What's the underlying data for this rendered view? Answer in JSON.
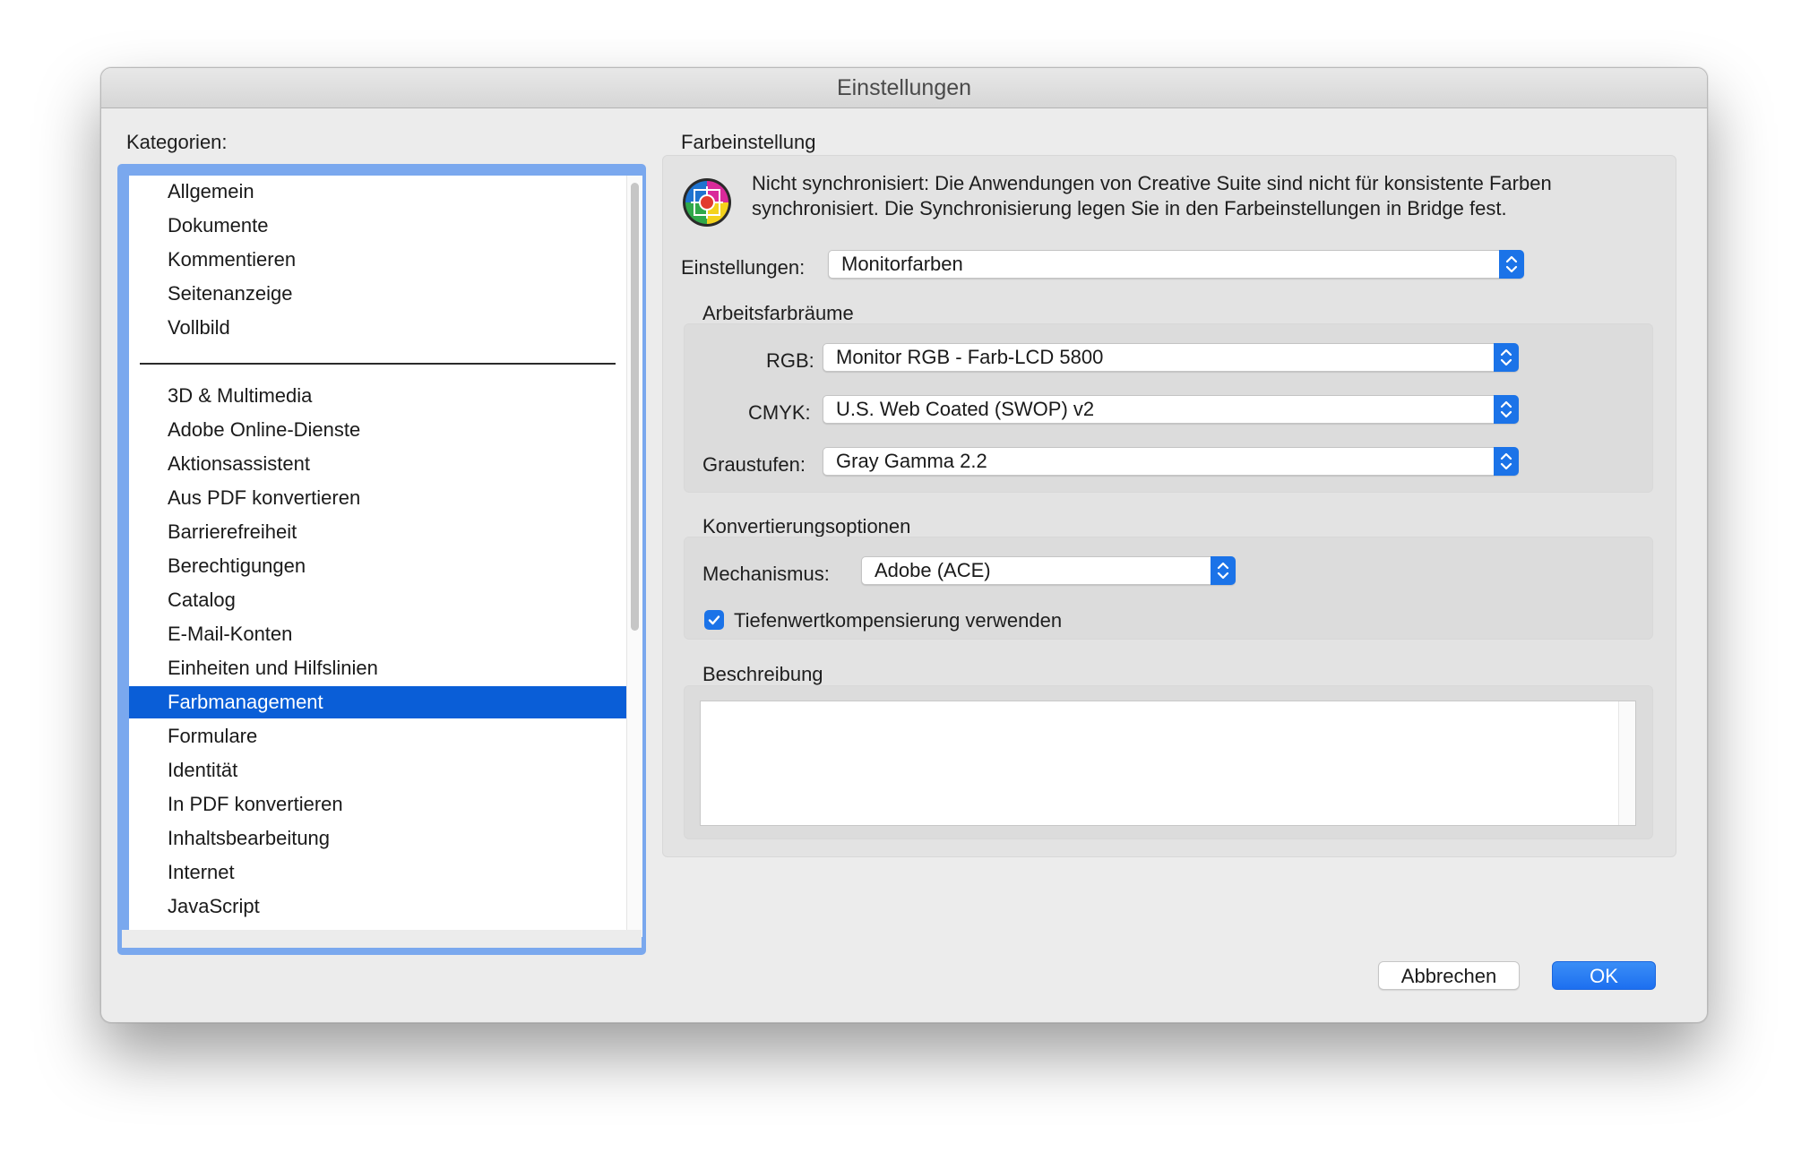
{
  "window": {
    "title": "Einstellungen"
  },
  "categories": {
    "label": "Kategorien:",
    "group1": [
      "Allgemein",
      "Dokumente",
      "Kommentieren",
      "Seitenanzeige",
      "Vollbild"
    ],
    "group2": [
      "3D & Multimedia",
      "Adobe Online-Dienste",
      "Aktionsassistent",
      "Aus PDF konvertieren",
      "Barrierefreiheit",
      "Berechtigungen",
      "Catalog",
      "E-Mail-Konten",
      "Einheiten und Hilfslinien",
      "Farbmanagement",
      "Formulare",
      "Identität",
      "In PDF konvertieren",
      "Inhaltsbearbeitung",
      "Internet",
      "JavaScript"
    ],
    "selected": "Farbmanagement"
  },
  "farbeinstellung": {
    "title": "Farbeinstellung",
    "status_line1": "Nicht synchronisiert: Die Anwendungen von Creative Suite sind nicht für konsistente Farben",
    "status_line2": "synchronisiert. Die Synchronisierung legen Sie in den Farbeinstellungen in Bridge fest.",
    "settings_label": "Einstellungen:",
    "settings_value": "Monitorfarben"
  },
  "arbeitsfarbraeume": {
    "title": "Arbeitsfarbräume",
    "rgb_label": "RGB:",
    "rgb_value": "Monitor RGB - Farb-LCD 5800",
    "cmyk_label": "CMYK:",
    "cmyk_value": "U.S. Web Coated (SWOP) v2",
    "gray_label": "Graustufen:",
    "gray_value": "Gray Gamma 2.2"
  },
  "konvertierung": {
    "title": "Konvertierungsoptionen",
    "engine_label": "Mechanismus:",
    "engine_value": "Adobe (ACE)",
    "bpc_label": "Tiefenwertkompensierung verwenden",
    "bpc_checked": true
  },
  "beschreibung": {
    "title": "Beschreibung"
  },
  "buttons": {
    "cancel": "Abbrechen",
    "ok": "OK"
  },
  "colors": {
    "accent": "#1b73e8",
    "selection": "#0a5ed7",
    "focus_ring": "#7aa8ee"
  }
}
